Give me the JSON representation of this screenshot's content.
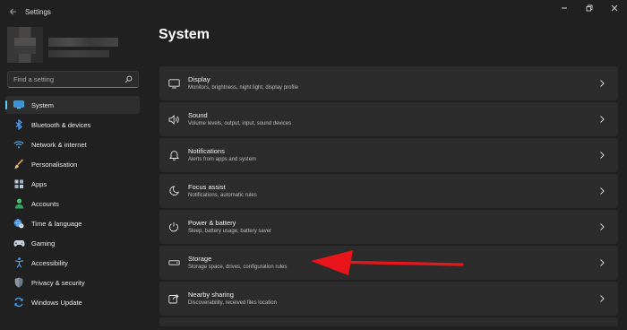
{
  "window": {
    "title": "Settings"
  },
  "search": {
    "placeholder": "Find a setting"
  },
  "sidebar": {
    "items": [
      {
        "label": "System",
        "icon": "display-icon",
        "active": true
      },
      {
        "label": "Bluetooth & devices",
        "icon": "bluetooth-icon"
      },
      {
        "label": "Network & internet",
        "icon": "wifi-icon"
      },
      {
        "label": "Personalisation",
        "icon": "brush-icon"
      },
      {
        "label": "Apps",
        "icon": "apps-icon"
      },
      {
        "label": "Accounts",
        "icon": "person-icon"
      },
      {
        "label": "Time & language",
        "icon": "globe-clock-icon"
      },
      {
        "label": "Gaming",
        "icon": "gamepad-icon"
      },
      {
        "label": "Accessibility",
        "icon": "accessibility-icon"
      },
      {
        "label": "Privacy & security",
        "icon": "shield-icon"
      },
      {
        "label": "Windows Update",
        "icon": "update-icon"
      }
    ]
  },
  "main": {
    "title": "System",
    "cards": [
      {
        "title": "Display",
        "subtitle": "Monitors, brightness, night light, display profile",
        "icon": "monitor-icon"
      },
      {
        "title": "Sound",
        "subtitle": "Volume levels, output, input, sound devices",
        "icon": "speaker-icon"
      },
      {
        "title": "Notifications",
        "subtitle": "Alerts from apps and system",
        "icon": "bell-icon"
      },
      {
        "title": "Focus assist",
        "subtitle": "Notifications, automatic rules",
        "icon": "moon-icon"
      },
      {
        "title": "Power & battery",
        "subtitle": "Sleep, battery usage, battery saver",
        "icon": "power-icon"
      },
      {
        "title": "Storage",
        "subtitle": "Storage space, drives, configuration rules",
        "icon": "storage-icon"
      },
      {
        "title": "Nearby sharing",
        "subtitle": "Discoverability, received files location",
        "icon": "share-icon"
      }
    ]
  },
  "colors": {
    "accent": "#60cdff",
    "background": "#202020",
    "card": "#2b2b2b",
    "annotation_arrow": "#e8141a"
  }
}
